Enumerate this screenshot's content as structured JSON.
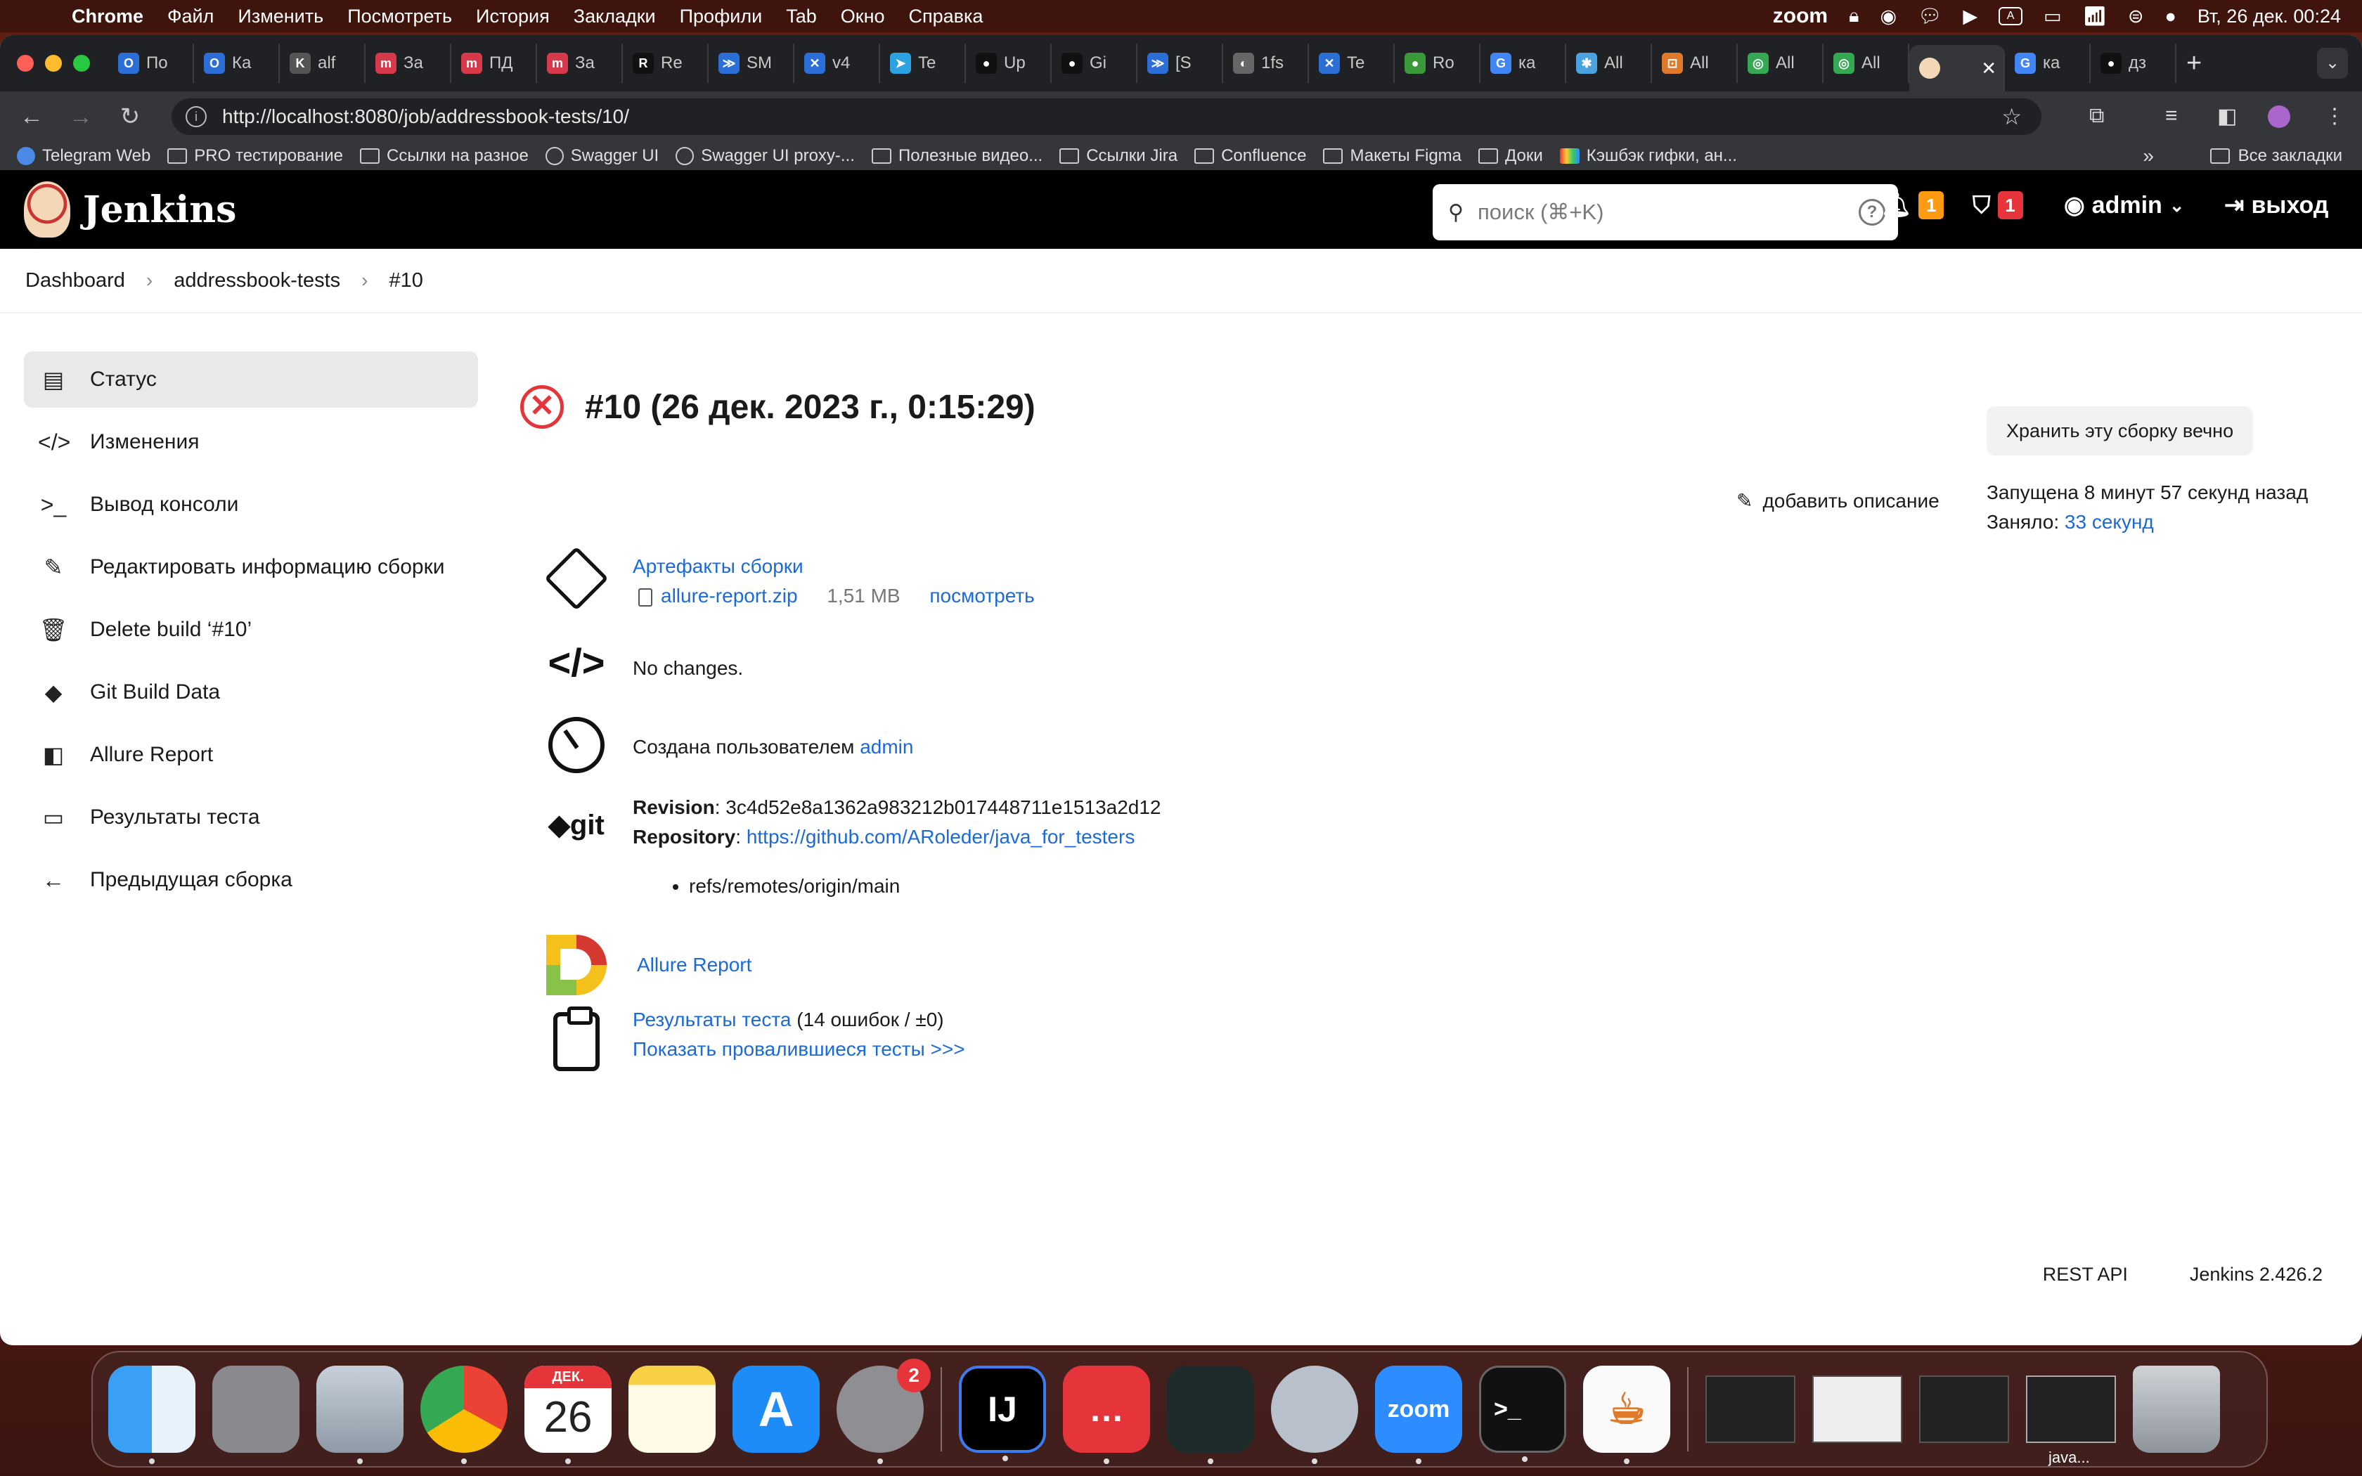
{
  "menubar": {
    "app": "Chrome",
    "items": [
      "Файл",
      "Изменить",
      "Посмотреть",
      "История",
      "Закладки",
      "Профили",
      "Tab",
      "Окно",
      "Справка"
    ],
    "zoom": "zoom",
    "clock": "Вт, 26 дек.  00:24"
  },
  "tabs": [
    {
      "label": "По",
      "color": "#2b6fd6",
      "glyph": "O"
    },
    {
      "label": "Ка",
      "color": "#2b6fd6",
      "glyph": "O"
    },
    {
      "label": "alf",
      "color": "#555555",
      "glyph": "K"
    },
    {
      "label": "За",
      "color": "#d63a4a",
      "glyph": "m"
    },
    {
      "label": "ПД",
      "color": "#d63a4a",
      "glyph": "m"
    },
    {
      "label": "За",
      "color": "#d63a4a",
      "glyph": "m"
    },
    {
      "label": "Re",
      "color": "#111111",
      "glyph": "R"
    },
    {
      "label": "SM",
      "color": "#2b6fd6",
      "glyph": "≫"
    },
    {
      "label": "v4",
      "color": "#2b6fd6",
      "glyph": "✕"
    },
    {
      "label": "Te",
      "color": "#2aa3e0",
      "glyph": "➤"
    },
    {
      "label": "Up",
      "color": "#111111",
      "glyph": "●"
    },
    {
      "label": "Gi",
      "color": "#111111",
      "glyph": "●"
    },
    {
      "label": "[S",
      "color": "#2b6fd6",
      "glyph": "≫"
    },
    {
      "label": "1fs",
      "color": "#666666",
      "glyph": "◐"
    },
    {
      "label": "Te",
      "color": "#2b6fd6",
      "glyph": "✕"
    },
    {
      "label": "Ro",
      "color": "#3a9a3a",
      "glyph": "●"
    },
    {
      "label": "ка",
      "color": "#4285f4",
      "glyph": "G"
    },
    {
      "label": "All",
      "color": "#4aa3df",
      "glyph": "✱"
    },
    {
      "label": "All",
      "color": "#e07a2a",
      "glyph": "⊡"
    },
    {
      "label": "All",
      "color": "#34a853",
      "glyph": "◎"
    },
    {
      "label": "All",
      "color": "#34a853",
      "glyph": "◎"
    }
  ],
  "active_tab_label": "",
  "tabs_after": [
    {
      "label": "ка",
      "color": "#4285f4",
      "glyph": "G"
    },
    {
      "label": "дз",
      "color": "#111111",
      "glyph": "●"
    }
  ],
  "address": {
    "url": "http://localhost:8080/job/addressbook-tests/10/"
  },
  "bookmarks": [
    {
      "label": "Telegram Web",
      "icon": "telegram-icon"
    },
    {
      "label": "PRO тестирование",
      "icon": "folder-icon"
    },
    {
      "label": "Ссылки на разное",
      "icon": "folder-icon"
    },
    {
      "label": "Swagger UI",
      "icon": "globe-icon"
    },
    {
      "label": "Swagger UI proxy-...",
      "icon": "globe-icon"
    },
    {
      "label": "Полезные видео...",
      "icon": "folder-icon"
    },
    {
      "label": "Ссылки Jira",
      "icon": "folder-icon"
    },
    {
      "label": "Confluence",
      "icon": "folder-icon"
    },
    {
      "label": "Макеты Figma",
      "icon": "folder-icon"
    },
    {
      "label": "Доки",
      "icon": "folder-icon"
    },
    {
      "label": "Кэшбэк гифки, ан...",
      "icon": "colorful-icon"
    }
  ],
  "bookmarks_all": "Все закладки",
  "jenkins": {
    "title": "Jenkins",
    "search_placeholder": "поиск (⌘+K)",
    "notif_count": "1",
    "security_count": "1",
    "user": "admin",
    "logout": "выход"
  },
  "breadcrumbs": [
    "Dashboard",
    "addressbook-tests",
    "#10"
  ],
  "sidebar": [
    {
      "label": "Статус",
      "icon": "status-doc-icon",
      "glyph": "▤",
      "active": true
    },
    {
      "label": "Изменения",
      "icon": "code-icon",
      "glyph": "</>"
    },
    {
      "label": "Вывод консоли",
      "icon": "terminal-icon",
      "glyph": ">_"
    },
    {
      "label": "Редактировать информацию сборки",
      "icon": "edit-icon",
      "glyph": "✎"
    },
    {
      "label": "Delete build ‘#10’",
      "icon": "trash-icon",
      "glyph": "🗑"
    },
    {
      "label": "Git Build Data",
      "icon": "git-icon",
      "glyph": "◆"
    },
    {
      "label": "Allure Report",
      "icon": "allure-icon",
      "glyph": "◧"
    },
    {
      "label": "Результаты теста",
      "icon": "clipboard-icon",
      "glyph": "▭"
    },
    {
      "label": "Предыдущая сборка",
      "icon": "arrow-left-icon",
      "glyph": "←"
    }
  ],
  "build": {
    "title": "#10 (26 дек. 2023 г., 0:15:29)",
    "keep_button": "Хранить эту сборку вечно",
    "add_description": "добавить описание",
    "started": "Запущена 8 минут 57 секунд назад",
    "took_label": "Заняло:",
    "took_value": "33 секунд",
    "artifacts_title": "Артефакты сборки",
    "artifact_file": "allure-report.zip",
    "artifact_size": "1,51 MB",
    "artifact_view": "посмотреть",
    "no_changes": "No changes.",
    "created_by_label": "Создана пользователем",
    "created_by_user": "admin",
    "revision_label": "Revision",
    "revision_value": "3c4d52e8a1362a983212b017448711e1513a2d12",
    "repository_label": "Repository",
    "repository_value": "https://github.com/ARoleder/java_for_testers",
    "ref": "refs/remotes/origin/main",
    "allure_link": "Allure Report",
    "tests_link": "Результаты теста",
    "tests_summary": "(14 ошибок / ±0)",
    "failed_tests_link": "Показать провалившиеся тесты >>>"
  },
  "footer": {
    "rest_api": "REST API",
    "version": "Jenkins 2.426.2"
  },
  "dock": {
    "calendar_month": "ДЕК.",
    "calendar_day": "26",
    "settings_badge": "2",
    "zoom_label": "zoom",
    "java_label": "java..."
  }
}
